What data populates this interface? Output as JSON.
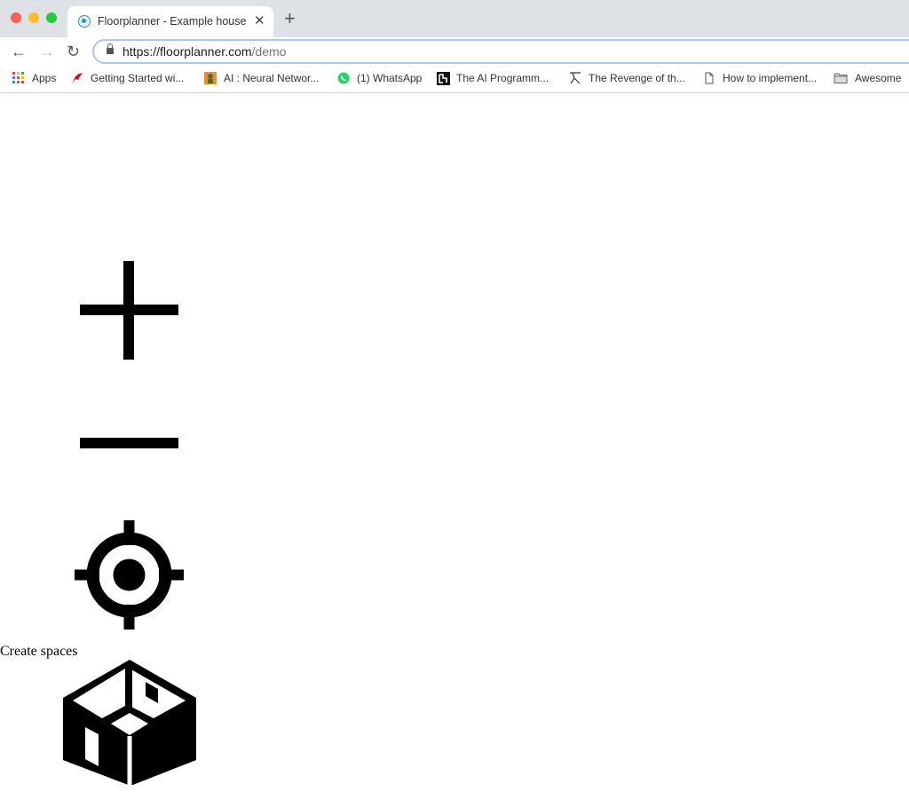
{
  "browser": {
    "tab": {
      "title": "Floorplanner - Example house",
      "close_label": "✕"
    },
    "new_tab_label": "+",
    "nav": {
      "back": "←",
      "forward": "→",
      "reload": "↻"
    },
    "url": {
      "scheme": "https://",
      "host": "floorplanner.com",
      "path": "/demo"
    },
    "bookmarks": [
      {
        "label": "Apps",
        "icon": "apps-grid-icon"
      },
      {
        "label": "Getting Started wi...",
        "icon": "getting-started-favicon"
      },
      {
        "label": "AI : Neural Networ...",
        "icon": "neural-network-favicon"
      },
      {
        "label": "(1) WhatsApp",
        "icon": "whatsapp-icon"
      },
      {
        "label": "The AI Programm...",
        "icon": "ai-programmer-favicon"
      },
      {
        "label": "The Revenge of th...",
        "icon": "revenge-favicon"
      },
      {
        "label": "How to implement...",
        "icon": "document-icon"
      },
      {
        "label": "Awesome",
        "icon": "folder-icon"
      }
    ]
  },
  "page": {
    "controls": [
      {
        "name": "zoom-in",
        "icon": "plus-icon"
      },
      {
        "name": "zoom-out",
        "icon": "minus-icon"
      },
      {
        "name": "center",
        "icon": "crosshair-icon"
      }
    ],
    "create_spaces_label": "Create spaces",
    "create_spaces_icon": "isometric-room-icon"
  }
}
